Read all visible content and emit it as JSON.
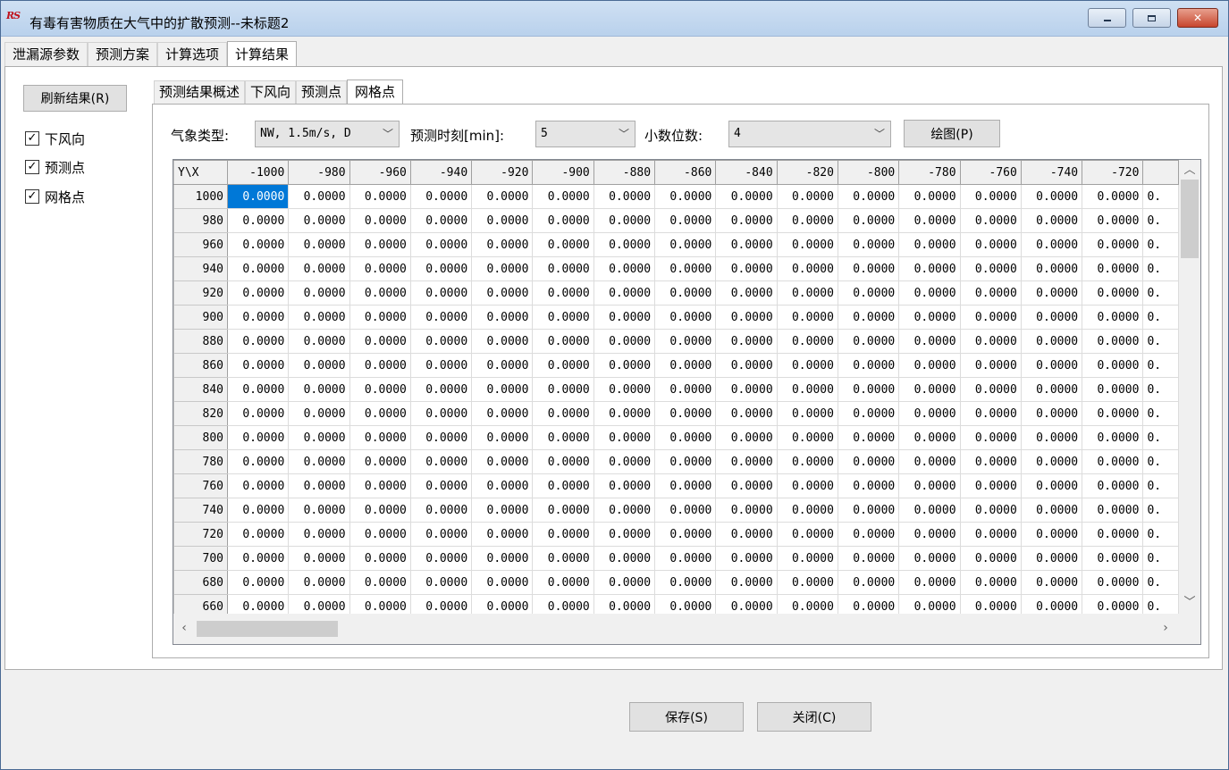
{
  "window": {
    "title": "有毒有害物质在大气中的扩散预测--未标题2",
    "icon_text": "RS"
  },
  "main_tabs": [
    {
      "label": "泄漏源参数",
      "active": false
    },
    {
      "label": "预测方案",
      "active": false
    },
    {
      "label": "计算选项",
      "active": false
    },
    {
      "label": "计算结果",
      "active": true
    }
  ],
  "left_panel": {
    "refresh_label": "刷新结果(R)",
    "checks": [
      {
        "label": "下风向",
        "checked": true
      },
      {
        "label": "预测点",
        "checked": true
      },
      {
        "label": "网格点",
        "checked": true
      }
    ]
  },
  "sub_tabs": [
    {
      "label": "预测结果概述",
      "active": false
    },
    {
      "label": "下风向",
      "active": false
    },
    {
      "label": "预测点",
      "active": false
    },
    {
      "label": "网格点",
      "active": true
    }
  ],
  "controls": {
    "weather_label": "气象类型:",
    "weather_value": "NW, 1.5m/s, D",
    "time_label": "预测时刻[min]:",
    "time_value": "5",
    "decimals_label": "小数位数:",
    "decimals_value": "4",
    "plot_label": "绘图(P)"
  },
  "grid": {
    "corner": "Y\\X",
    "columns": [
      "-1000",
      "-980",
      "-960",
      "-940",
      "-920",
      "-900",
      "-880",
      "-860",
      "-840",
      "-820",
      "-800",
      "-780",
      "-760",
      "-740",
      "-720"
    ],
    "rows": [
      "1000",
      "980",
      "960",
      "940",
      "920",
      "900",
      "880",
      "860",
      "840",
      "820",
      "800",
      "780",
      "760",
      "740",
      "720",
      "700",
      "680",
      "660"
    ],
    "cell_value": "0.0000",
    "partial_value": "0.",
    "selected": {
      "row": 0,
      "col": 0
    }
  },
  "footer": {
    "save_label": "保存(S)",
    "close_label": "关闭(C)"
  }
}
